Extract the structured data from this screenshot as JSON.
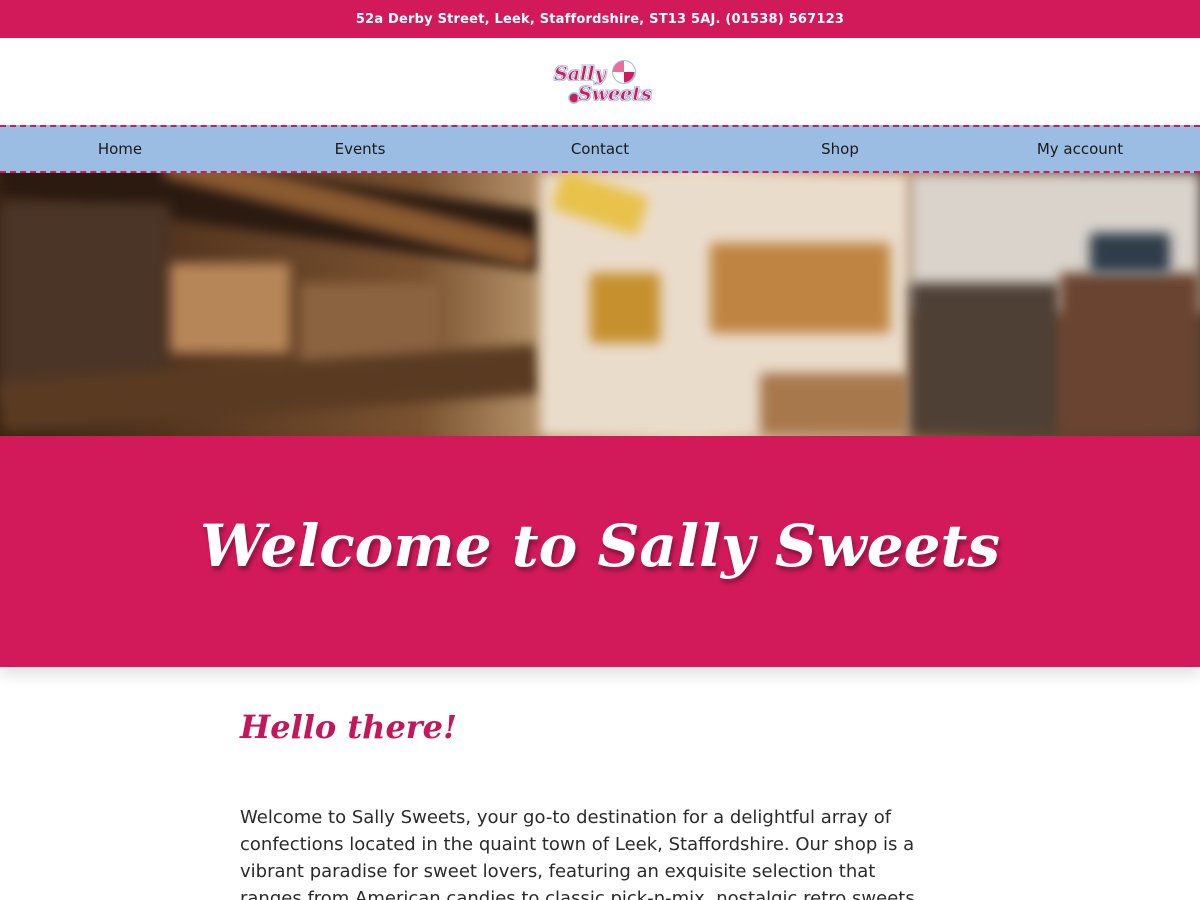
{
  "topbar": {
    "address": "52a Derby Street, Leek, Staffordshire, ST13 5AJ. (01538) 567123"
  },
  "logo": {
    "line1": "Sally",
    "line2": "Sweets",
    "icon": "lollipop-icon"
  },
  "nav": {
    "items": [
      {
        "label": "Home"
      },
      {
        "label": "Events"
      },
      {
        "label": "Contact"
      },
      {
        "label": "Shop"
      },
      {
        "label": "My account"
      }
    ]
  },
  "hero": {
    "title": "Welcome to Sally Sweets"
  },
  "main": {
    "heading": "Hello there!",
    "intro": "Welcome to Sally Sweets, your go-to destination for a delightful array of confections located in the quaint town of Leek, Staffordshire. Our shop is a vibrant paradise for sweet lovers, featuring an exquisite selection that ranges from American candies to classic pick-n-mix, nostalgic retro sweets, and"
  },
  "colors": {
    "brand": "#d21a5b",
    "nav": "#9bbde3"
  }
}
